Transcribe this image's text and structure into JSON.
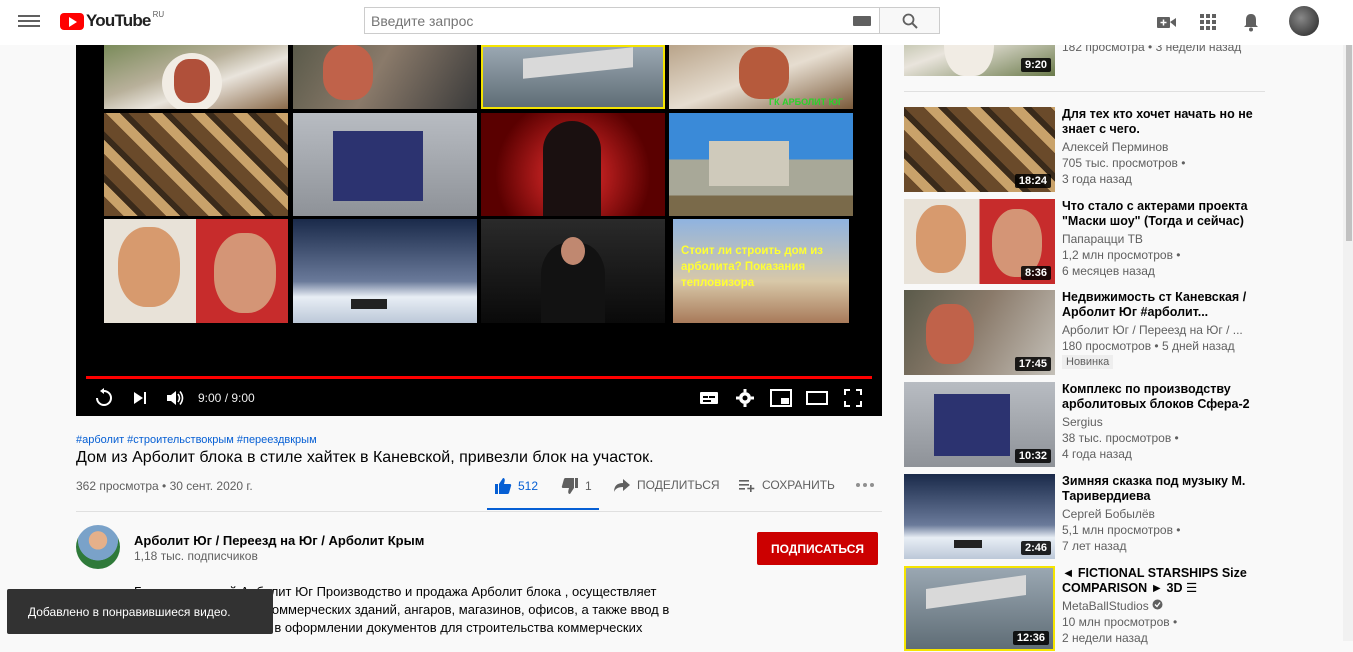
{
  "header": {
    "logo_text": "YouTube",
    "logo_region": "RU",
    "search_placeholder": "Введите запрос"
  },
  "player": {
    "time": "9:00 / 9:00",
    "progress": 1.0,
    "end_screen_thumbs": [
      {
        "overlay": "ГК АРБОЛИТ ЮГ"
      },
      {
        "overlay": "Стоит ли строить дом из арболита? Показания тепловизора"
      }
    ]
  },
  "video": {
    "hashtags": "#арболит #строительствокрым #переездвкрым",
    "title": "Дом из Арболит блока в стиле хайтек в Каневской, привезли блок на участок.",
    "views_date": "362 просмотра • 30 сент. 2020 г.",
    "likes": "512",
    "dislikes": "1",
    "share_label": "ПОДЕЛИТЬСЯ",
    "save_label": "СОХРАНИТЬ"
  },
  "channel": {
    "name": "Арболит Юг / Переезд на Юг / Арболит Крым",
    "subs": "1,18 тыс. подписчиков",
    "subscribe_label": "ПОДПИСАТЬСЯ"
  },
  "description": [
    "Группа компаний Арболит Юг Производство и продажа Арболит блока , осуществляет",
    "коммерческих зданий, ангаров, магазинов, офисов, а также ввод в",
    "ь в оформлении документов для строительства коммерческих"
  ],
  "toast": "Добавлено в понравившиеся видео.",
  "sidebar": {
    "top_partial": {
      "meta": "182 просмотра • 3 недели назад",
      "duration": "9:20"
    },
    "items": [
      {
        "title": "Для тех кто хочет начать но не знает с чего.",
        "channel": "Алексей Перминов",
        "views": "705 тыс. просмотров •",
        "age": "3 года назад",
        "duration": "18:24"
      },
      {
        "title": "Что стало с актерами проекта \"Маски шоу\" (Тогда и сейчас)",
        "channel": "Папарацци ТВ",
        "views": "1,2 млн просмотров •",
        "age": "6 месяцев назад",
        "duration": "8:36"
      },
      {
        "title": "Недвижимость ст Каневская / Арболит Юг #арболит...",
        "channel": "Арболит Юг / Переезд на Юг / ...",
        "views": "180 просмотров • 5 дней назад",
        "age": "",
        "badge": "Новинка",
        "duration": "17:45"
      },
      {
        "title": "Комплекс по производству арболитовых блоков Сфера-2",
        "channel": "Sergius",
        "views": "38 тыс. просмотров •",
        "age": "4 года назад",
        "duration": "10:32"
      },
      {
        "title": "Зимняя сказка под музыку М. Таривердиева",
        "channel": "Сергей Бобылёв",
        "views": "5,1 млн просмотров •",
        "age": "7 лет назад",
        "duration": "2:46"
      },
      {
        "title": "◄ FICTIONAL STARSHIPS Size COMPARISON ► 3D ☰",
        "channel": "MetaBallStudios",
        "views": "10 млн просмотров •",
        "age": "2 недели назад",
        "duration": "12:36"
      }
    ]
  }
}
